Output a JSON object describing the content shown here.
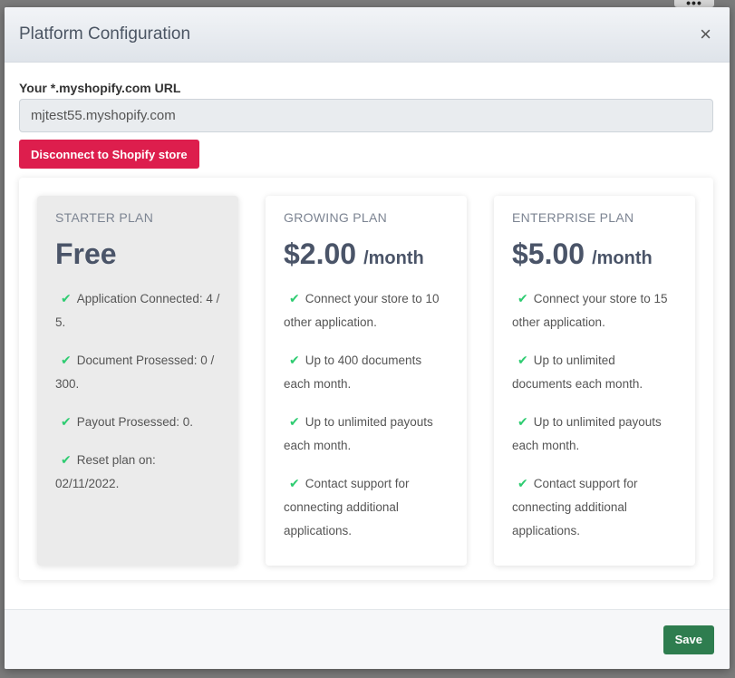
{
  "backdrop": {
    "menu_glyph": "•••"
  },
  "modal": {
    "title": "Platform Configuration",
    "close_glyph": "×"
  },
  "form": {
    "url_label": "Your *.myshopify.com URL",
    "url_value": "mjtest55.myshopify.com",
    "disconnect_label": "Disconnect to Shopify store"
  },
  "plans": [
    {
      "name": "STARTER PLAN",
      "price": "Free",
      "period": "",
      "features": [
        "Application Connected: 4 / 5.",
        "Document Prosessed: 0 / 300.",
        "Payout Prosessed: 0.",
        "Reset plan on: 02/11/2022."
      ]
    },
    {
      "name": "GROWING PLAN",
      "price": "$2.00",
      "period": "/month",
      "features": [
        "Connect your store to 10 other application.",
        "Up to 400 documents each month.",
        "Up to unlimited payouts each month.",
        "Contact support for connecting additional applications."
      ]
    },
    {
      "name": "ENTERPRISE PLAN",
      "price": "$5.00",
      "period": "/month",
      "features": [
        "Connect your store to 15 other application.",
        "Up to unlimited documents each month.",
        "Up to unlimited payouts each month.",
        "Contact support for connecting additional applications."
      ]
    }
  ],
  "footer": {
    "save_label": "Save"
  },
  "icons": {
    "check": "✔",
    "check_icon_name": "check-icon",
    "close_icon_name": "close-icon"
  },
  "colors": {
    "disconnect_button": "#dd1e4d",
    "save_button": "#2e7d4f",
    "check": "#2ecc71",
    "price_text": "#4a5468"
  }
}
